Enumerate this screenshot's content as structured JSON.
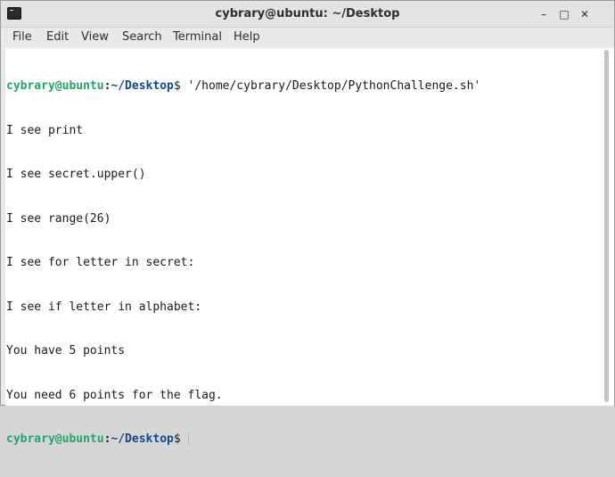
{
  "window": {
    "title": "cybrary@ubuntu: ~/Desktop",
    "controls": {
      "minimize": "–",
      "maximize": "□",
      "close": "✕"
    }
  },
  "menu": {
    "file": "File",
    "edit": "Edit",
    "view": "View",
    "search": "Search",
    "terminal": "Terminal",
    "help": "Help"
  },
  "prompt": {
    "user": "cybrary@ubuntu",
    "colon": ":",
    "path": "~/Desktop",
    "dollar": "$"
  },
  "terminal": {
    "command": " '/home/cybrary/Desktop/PythonChallenge.sh'",
    "output": [
      "I see print",
      "I see secret.upper()",
      "I see range(26)",
      "I see for letter in secret:",
      "I see if letter in alphabet:",
      "You have 5 points",
      "You need 6 points for the flag."
    ]
  },
  "colors": {
    "prompt_user": "#26a269",
    "prompt_path": "#12488b"
  }
}
